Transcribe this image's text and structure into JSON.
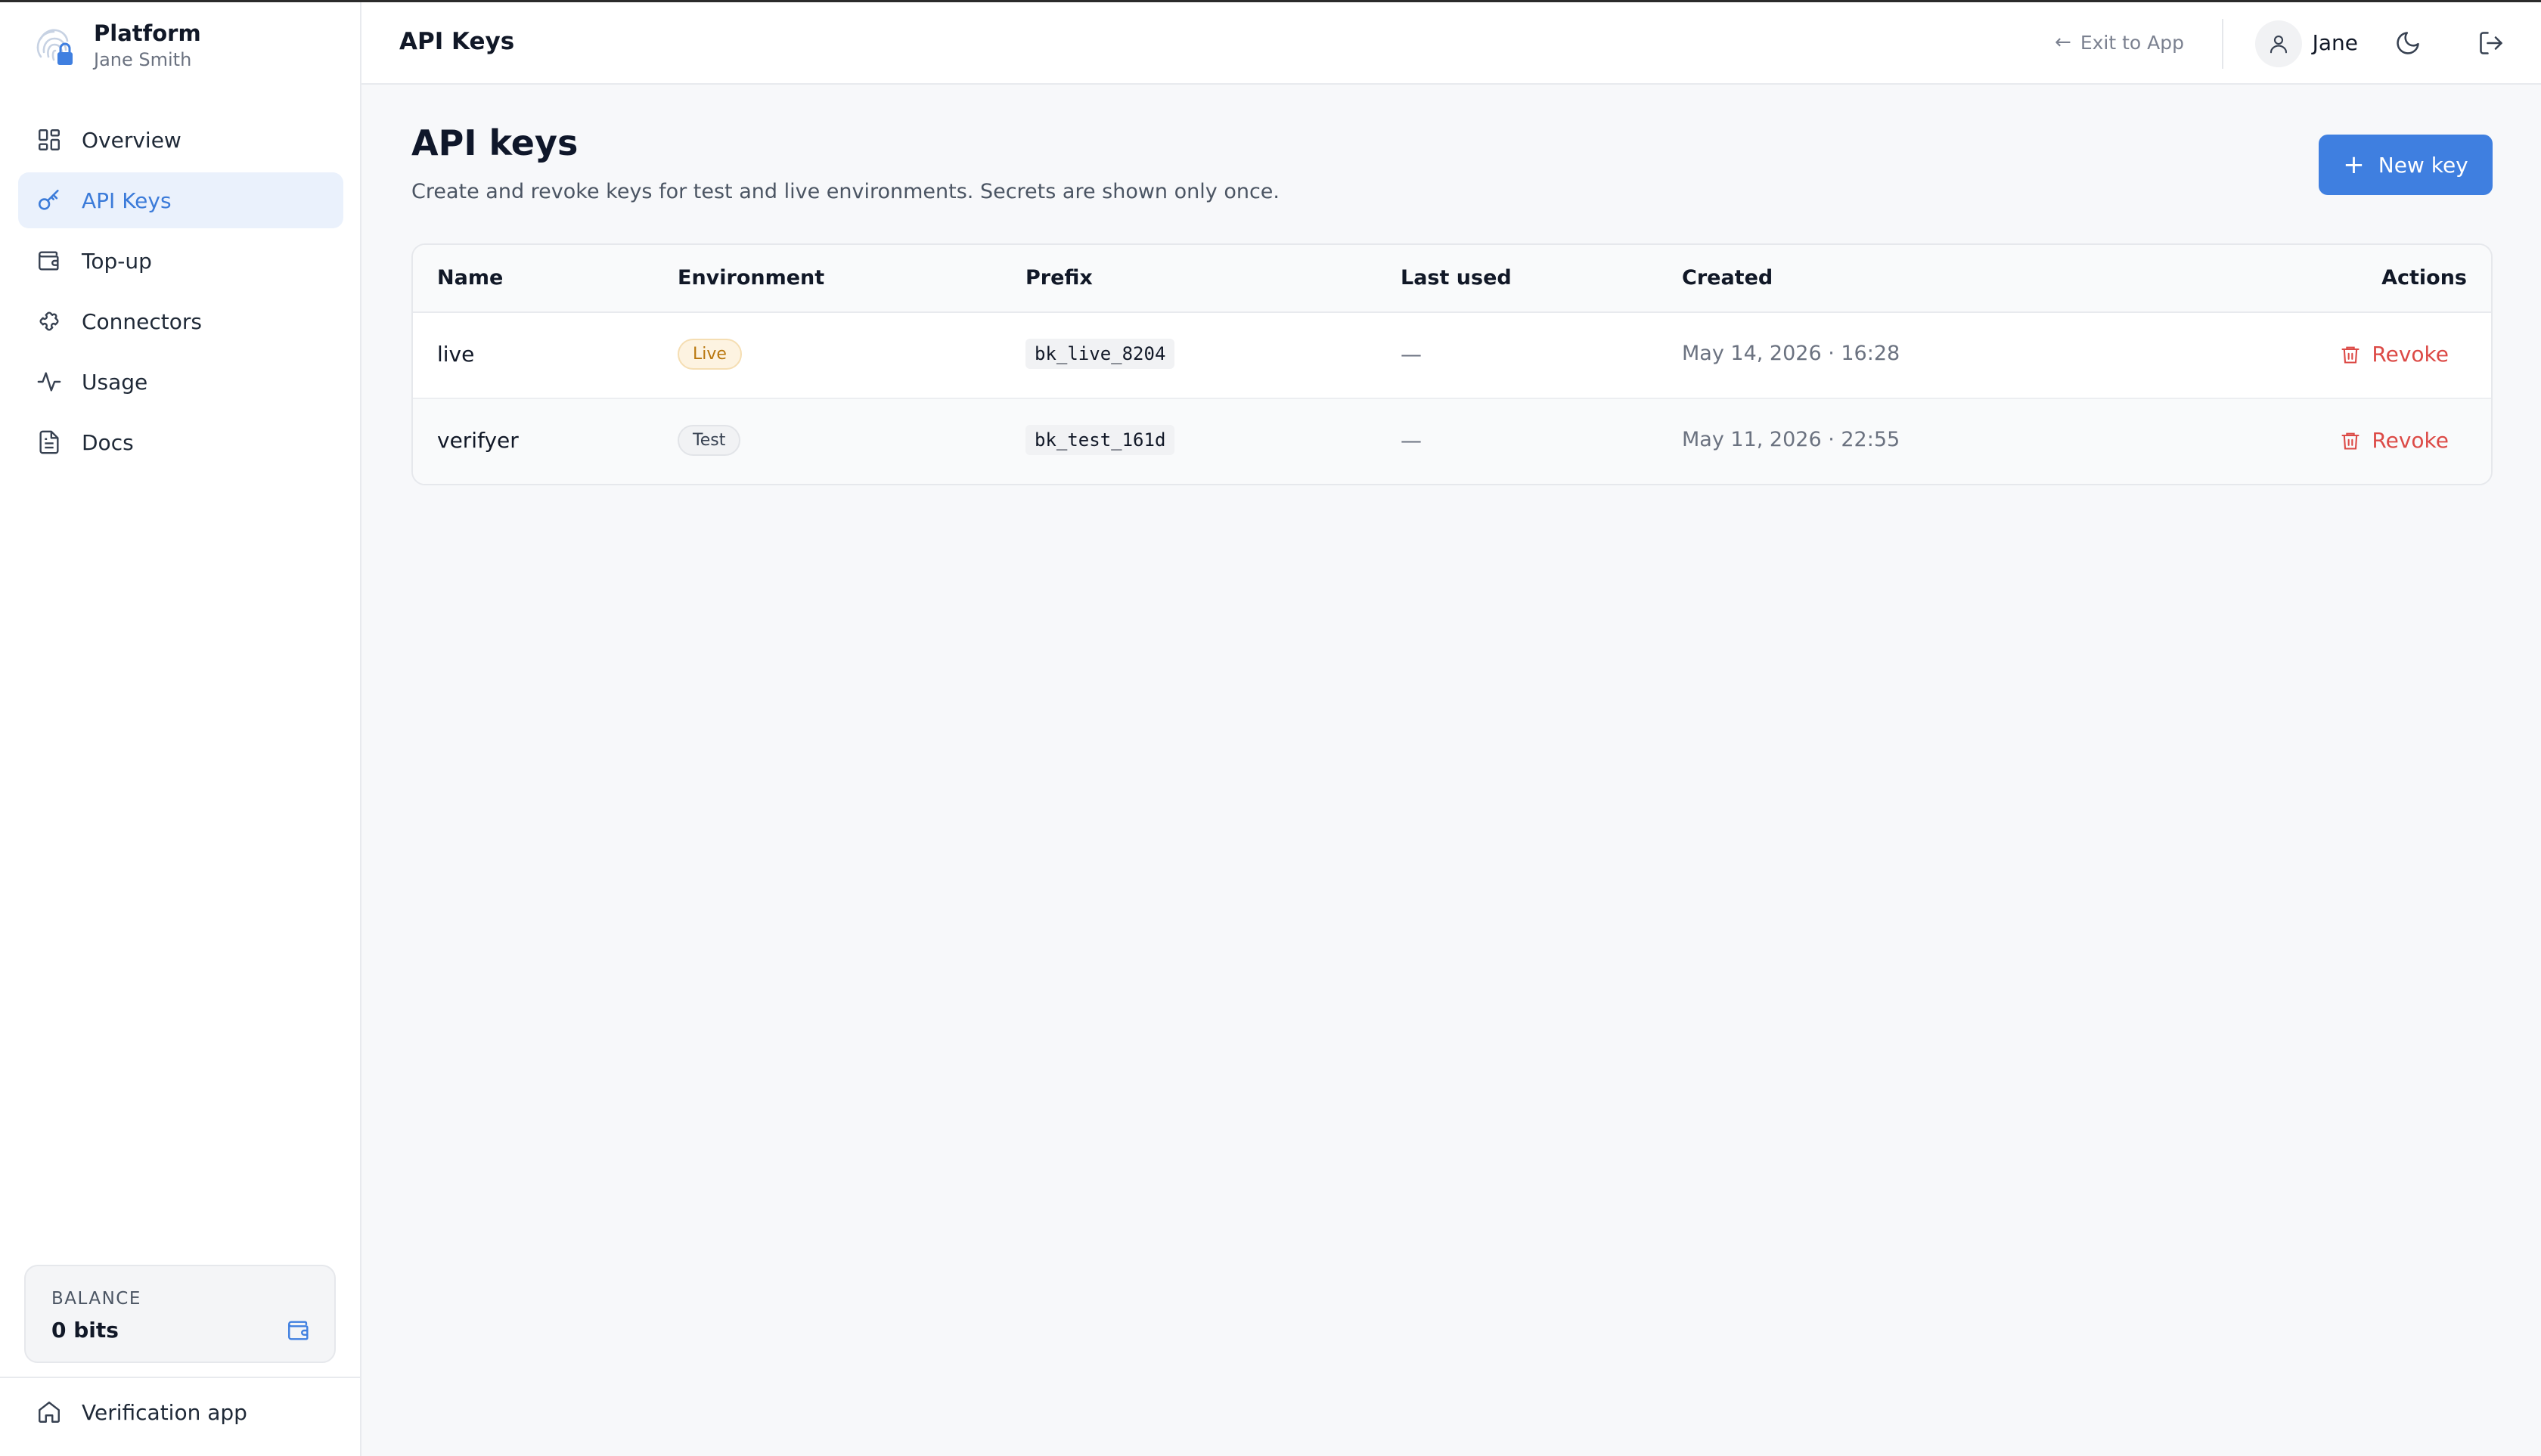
{
  "brand": {
    "title": "Platform",
    "user": "Jane Smith"
  },
  "sidebar": {
    "items": [
      {
        "label": "Overview",
        "icon": "grid-icon"
      },
      {
        "label": "API Keys",
        "icon": "key-icon",
        "active": true
      },
      {
        "label": "Top-up",
        "icon": "wallet-icon"
      },
      {
        "label": "Connectors",
        "icon": "puzzle-icon"
      },
      {
        "label": "Usage",
        "icon": "activity-icon"
      },
      {
        "label": "Docs",
        "icon": "document-icon"
      }
    ],
    "balance": {
      "label": "BALANCE",
      "value": "0 bits",
      "icon": "wallet-icon"
    },
    "footer": {
      "label": "Verification app",
      "icon": "home-icon"
    }
  },
  "header": {
    "title": "API Keys",
    "exit_label": "Exit to App",
    "user_name": "Jane",
    "icons": [
      "arrow-left-icon",
      "user-icon",
      "moon-icon",
      "logout-icon"
    ]
  },
  "main": {
    "title": "API keys",
    "description": "Create and revoke keys for test and live environments. Secrets are shown only once.",
    "new_key_label": "New key",
    "table": {
      "headers": {
        "name": "Name",
        "environment": "Environment",
        "prefix": "Prefix",
        "last_used": "Last used",
        "created": "Created",
        "actions": "Actions"
      },
      "rows": [
        {
          "name": "live",
          "environment": "Live",
          "prefix": "bk_live_8204",
          "last_used": "—",
          "created": "May 14, 2026 · 16:28",
          "action": "Revoke"
        },
        {
          "name": "verifyer",
          "environment": "Test",
          "prefix": "bk_test_161d",
          "last_used": "—",
          "created": "May 11, 2026 · 22:55",
          "action": "Revoke"
        }
      ]
    }
  },
  "colors": {
    "accent": "#3f7fe0",
    "active_bg": "#eaf1fc",
    "danger": "#dc4a46",
    "live_badge": "#b9770e"
  }
}
